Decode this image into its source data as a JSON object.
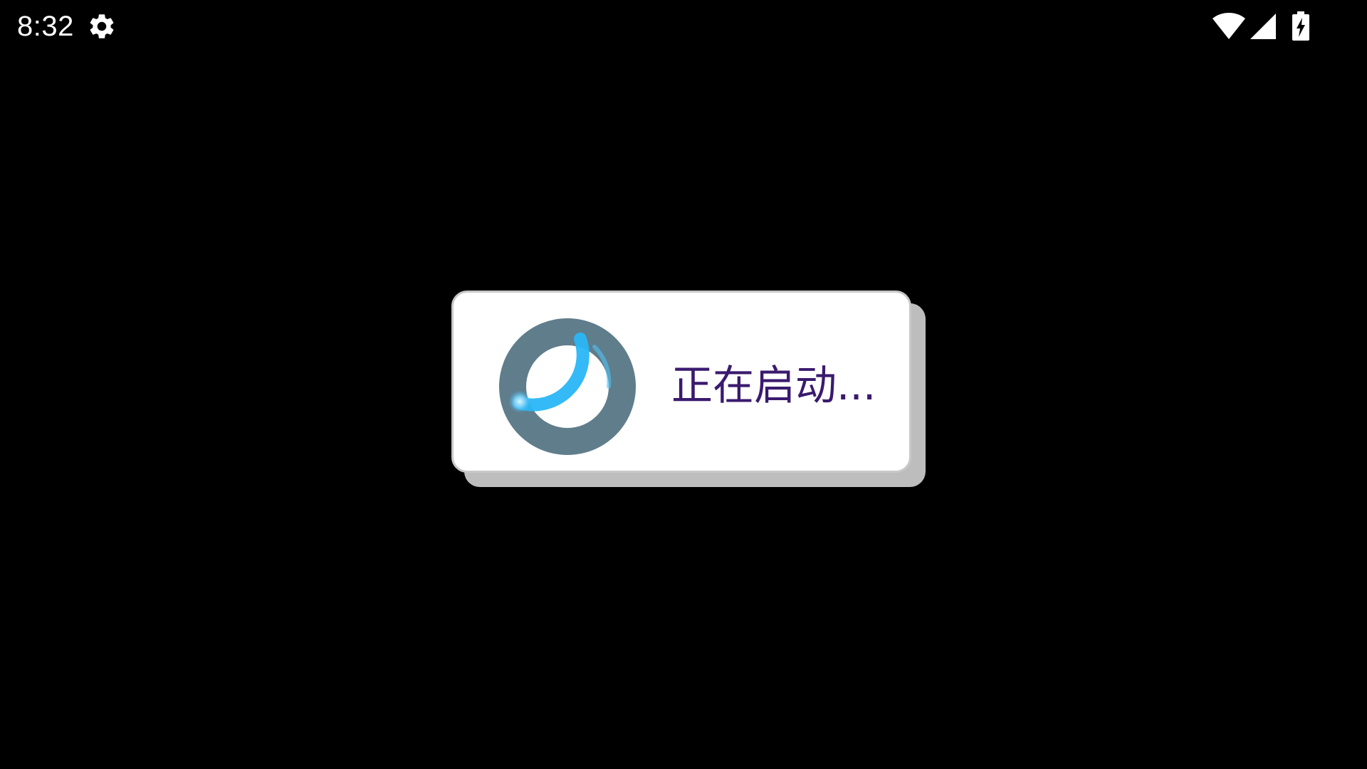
{
  "status_bar": {
    "time": "8:32",
    "left_icons": [
      "gear-icon"
    ],
    "right_icons": [
      "wifi-icon",
      "cell-signal-icon",
      "battery-charging-icon"
    ]
  },
  "dialog": {
    "message": "正在启动...",
    "spinner_icon": "loading-spinner-icon",
    "colors": {
      "background": "#ffffff",
      "text": "#3a1a6e",
      "spinner_track": "#607d8b",
      "spinner_arc": "#29b6f6"
    }
  },
  "colors": {
    "screen_background": "#000000",
    "status_text": "#ffffff"
  }
}
